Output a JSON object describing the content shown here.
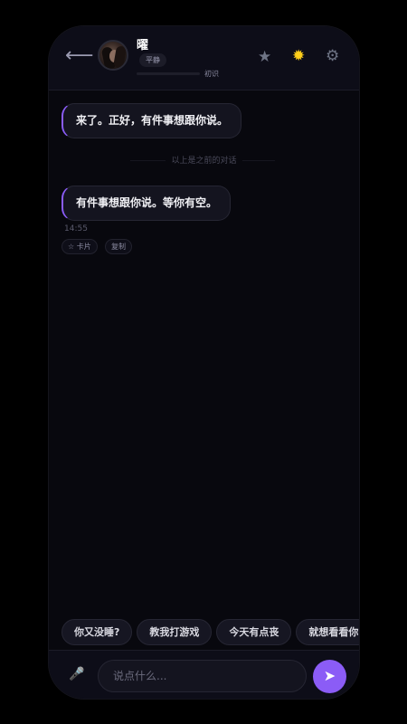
{
  "header": {
    "back_icon": "left-arrow",
    "back_glyph": "⟵",
    "name": "曜",
    "mood": "平静",
    "relation_level": "初识",
    "relation_progress": 0,
    "star_glyph": "★",
    "sun_glyph": "✹",
    "gear_glyph": "⚙",
    "sun_color": "#ffcf1a"
  },
  "messages": [
    {
      "text": "来了。正好，有件事想跟你说。"
    },
    {
      "text": "有件事想跟你说。等你有空。",
      "time": "14:55"
    }
  ],
  "divider_text": "以上是之前的对话",
  "message_actions": {
    "card_label": "☆ 卡片",
    "copy_label": "复制"
  },
  "suggestions": [
    "你又没睡?",
    "教我打游戏",
    "今天有点丧",
    "就想看看你"
  ],
  "input": {
    "mic_glyph": "🎤",
    "placeholder": "说点什么...",
    "value": "",
    "send_glyph": "➤"
  },
  "colors": {
    "accent": "#8b5cf6",
    "background": "#08080e"
  }
}
